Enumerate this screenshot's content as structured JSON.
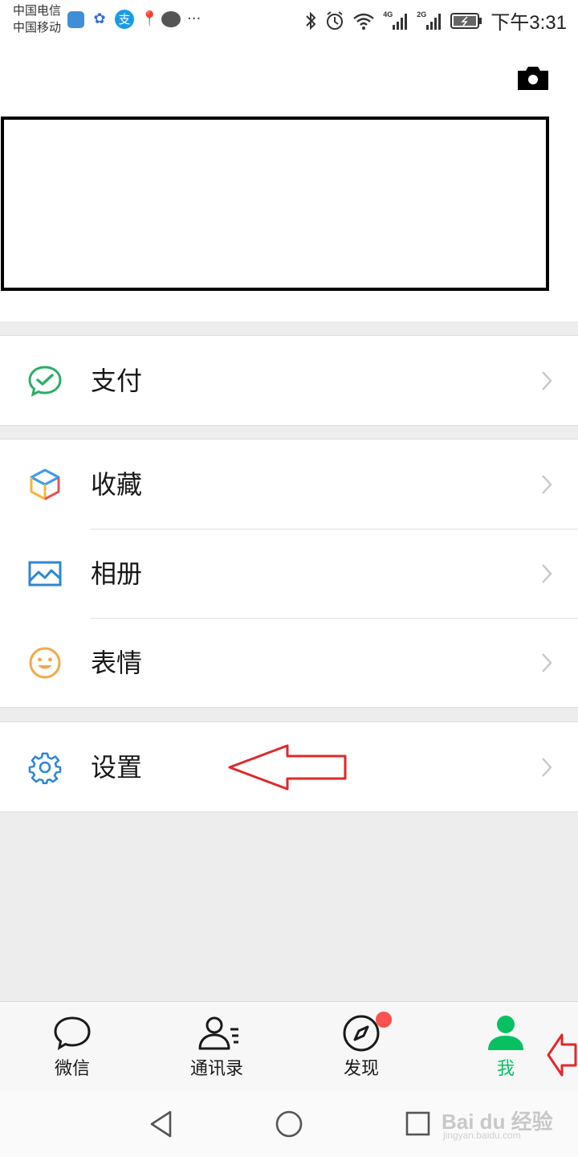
{
  "status_bar": {
    "carrier1": "中国电信",
    "carrier2": "中国移动",
    "more": "···",
    "net4g": "4G",
    "net2g": "2G",
    "time": "下午3:31",
    "icons": [
      "shield-app-icon",
      "baidu-app-icon",
      "alipay-app-icon",
      "map-pin-icon",
      "chat-bubble-icon",
      "bluetooth-icon",
      "alarm-icon",
      "wifi-icon",
      "signal-icon",
      "battery-icon"
    ]
  },
  "header": {
    "icon": "camera-icon"
  },
  "menu": {
    "pay": {
      "label": "支付",
      "icon": "wechat-pay-icon"
    },
    "favorites": {
      "label": "收藏",
      "icon": "favorites-cube-icon"
    },
    "album": {
      "label": "相册",
      "icon": "album-image-icon"
    },
    "stickers": {
      "label": "表情",
      "icon": "smiley-icon"
    },
    "settings": {
      "label": "设置",
      "icon": "gear-icon"
    }
  },
  "tabs": [
    {
      "label": "微信",
      "icon": "chat-icon",
      "active": false
    },
    {
      "label": "通讯录",
      "icon": "contacts-icon",
      "active": false
    },
    {
      "label": "发现",
      "icon": "compass-icon",
      "active": false,
      "badge": true
    },
    {
      "label": "我",
      "icon": "person-icon",
      "active": true
    }
  ],
  "watermark": {
    "text": "Bai du 经验",
    "sub": "jingyan.baidu.com"
  },
  "colors": {
    "accent_green": "#07c160",
    "annotation_red": "#e0282a",
    "badge_red": "#fa5151"
  }
}
